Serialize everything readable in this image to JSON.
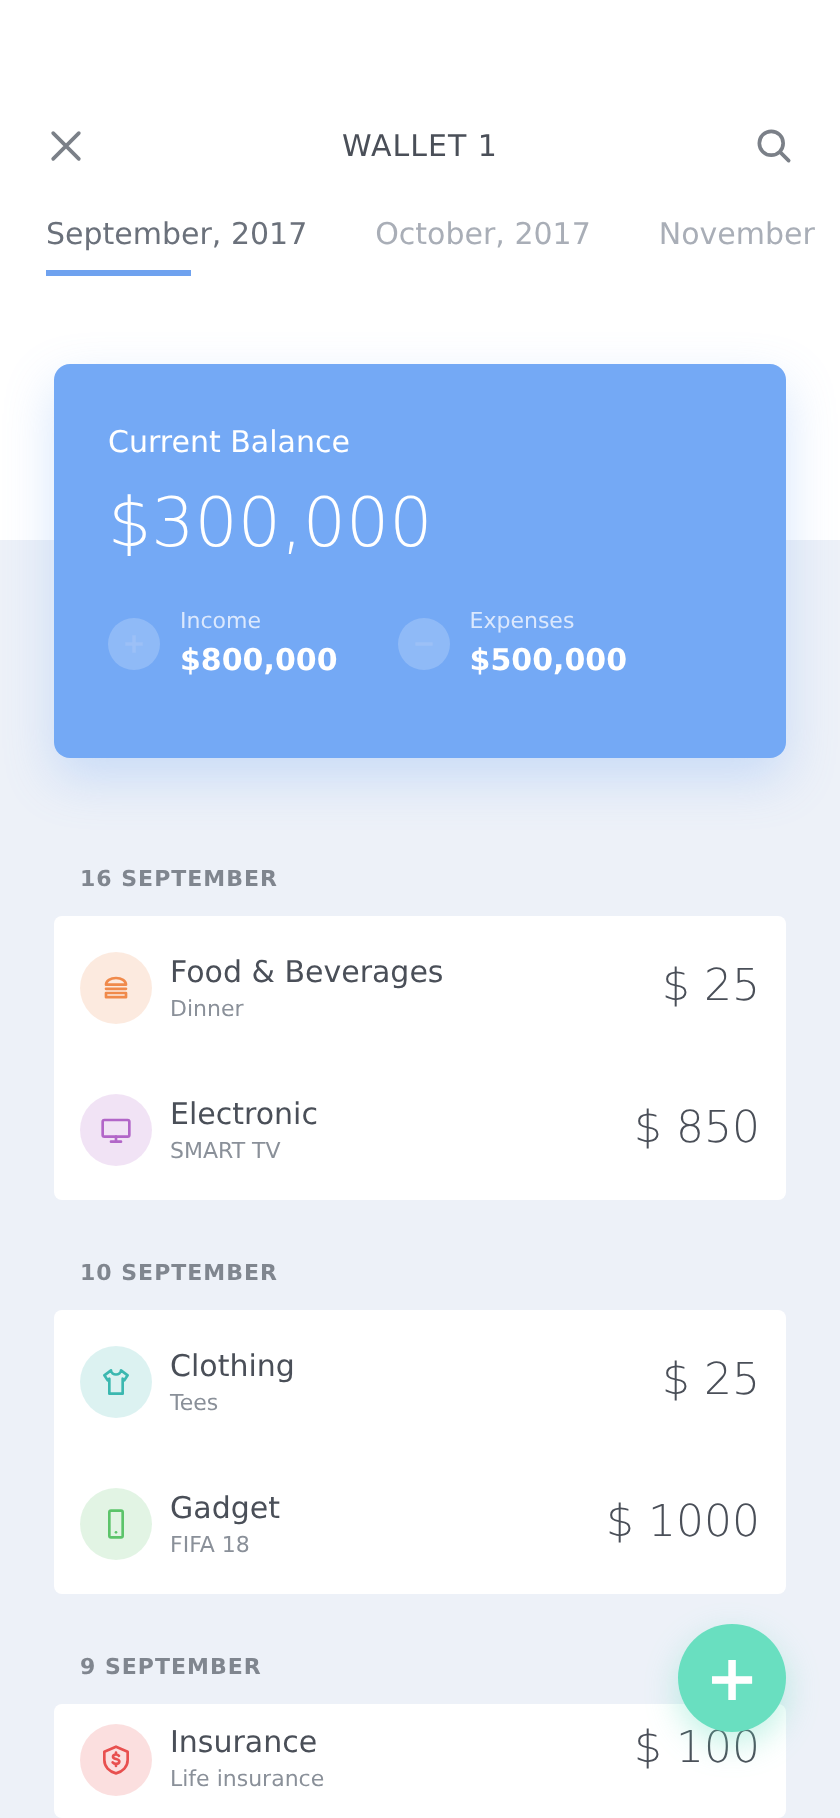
{
  "header": {
    "title": "WALLET 1"
  },
  "tabs": [
    {
      "label": "September, 2017",
      "selected": true
    },
    {
      "label": "October, 2017",
      "selected": false
    },
    {
      "label": "November",
      "selected": false
    }
  ],
  "balance": {
    "label": "Current Balance",
    "amount": "$300,000",
    "stats": [
      {
        "kind": "income",
        "label": "Income",
        "amount": "$800,000"
      },
      {
        "kind": "expense",
        "label": "Expenses",
        "amount": "$500,000"
      }
    ]
  },
  "days": [
    {
      "date": "16 SEPTEMBER",
      "transactions": [
        {
          "kind": "food",
          "color": "#f08a4b",
          "title": "Food & Beverages",
          "note": "Dinner",
          "amount": "$ 25"
        },
        {
          "kind": "tv",
          "color": "#b266c8",
          "title": "Electronic",
          "note": "SMART TV",
          "amount": "$ 850"
        }
      ]
    },
    {
      "date": "10 SEPTEMBER",
      "transactions": [
        {
          "kind": "shirt",
          "color": "#3bb8b0",
          "title": "Clothing",
          "note": "Tees",
          "amount": "$ 25"
        },
        {
          "kind": "phone",
          "color": "#5cc46a",
          "title": "Gadget",
          "note": "FIFA 18",
          "amount": "$ 1000"
        }
      ]
    },
    {
      "date": "9 SEPTEMBER",
      "transactions": [
        {
          "kind": "shield",
          "color": "#e8504f",
          "title": "Insurance",
          "note": "Life insurance",
          "amount": "$ 100"
        }
      ]
    }
  ],
  "fab": {
    "label": "+"
  }
}
